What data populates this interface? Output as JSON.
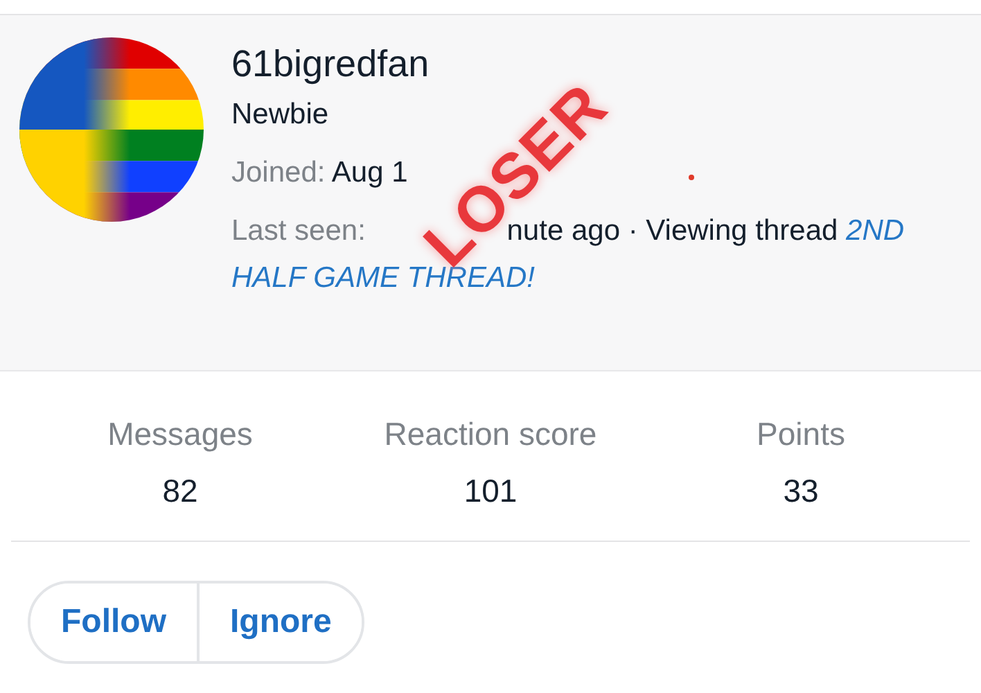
{
  "profile": {
    "username": "61bigredfan",
    "title": "Newbie",
    "joined": {
      "label": "Joined:",
      "value": "Aug 1"
    },
    "last_seen": {
      "label": "Last seen:",
      "value": "nute ago · Viewing thread",
      "link_lines": [
        "2ND",
        "HALF GAME THREAD!"
      ]
    }
  },
  "stamp": "LOSER",
  "stats": [
    {
      "label": "Messages",
      "value": "82"
    },
    {
      "label": "Reaction score",
      "value": "101"
    },
    {
      "label": "Points",
      "value": "33"
    }
  ],
  "buttons": [
    "Follow",
    "Ignore"
  ]
}
